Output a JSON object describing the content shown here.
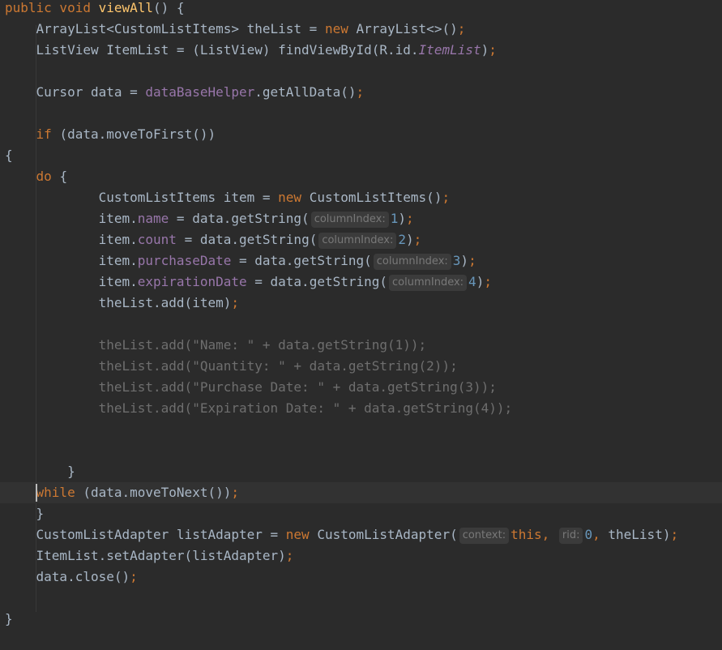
{
  "editor": {
    "lines": [
      {
        "indent": "",
        "tokens": [
          {
            "c": "kw",
            "t": "public void "
          },
          {
            "c": "fn",
            "t": "viewAll"
          },
          {
            "c": "",
            "t": "() {"
          }
        ]
      },
      {
        "indent": "    ",
        "tokens": [
          {
            "c": "",
            "t": "ArrayList<CustomListItems> theList = "
          },
          {
            "c": "kw",
            "t": "new "
          },
          {
            "c": "",
            "t": "ArrayList<>()"
          },
          {
            "c": "kw",
            "t": ";"
          }
        ]
      },
      {
        "indent": "    ",
        "tokens": [
          {
            "c": "",
            "t": "ListView ItemList = (ListView) findViewById(R.id."
          },
          {
            "c": "fldi",
            "t": "ItemList"
          },
          {
            "c": "",
            "t": ")"
          },
          {
            "c": "kw",
            "t": ";"
          }
        ]
      },
      {
        "indent": "",
        "tokens": []
      },
      {
        "indent": "    ",
        "tokens": [
          {
            "c": "",
            "t": "Cursor data = "
          },
          {
            "c": "fld",
            "t": "dataBaseHelper"
          },
          {
            "c": "",
            "t": ".getAllData()"
          },
          {
            "c": "kw",
            "t": ";"
          }
        ]
      },
      {
        "indent": "",
        "tokens": []
      },
      {
        "indent": "    ",
        "tokens": [
          {
            "c": "kw",
            "t": "if "
          },
          {
            "c": "",
            "t": "(data.moveToFirst())"
          }
        ]
      },
      {
        "indent": "",
        "tokens": [
          {
            "c": "",
            "t": "{"
          }
        ]
      },
      {
        "indent": "    ",
        "tokens": [
          {
            "c": "kw",
            "t": "do "
          },
          {
            "c": "",
            "t": "{"
          }
        ]
      },
      {
        "indent": "            ",
        "tokens": [
          {
            "c": "",
            "t": "CustomListItems item = "
          },
          {
            "c": "kw",
            "t": "new "
          },
          {
            "c": "",
            "t": "CustomListItems()"
          },
          {
            "c": "kw",
            "t": ";"
          }
        ]
      },
      {
        "indent": "            ",
        "tokens": [
          {
            "c": "",
            "t": "item."
          },
          {
            "c": "fld",
            "t": "name"
          },
          {
            "c": "",
            "t": " = data.getString("
          },
          {
            "c": "hint",
            "t": "columnIndex:"
          },
          {
            "c": "num",
            "t": "1"
          },
          {
            "c": "",
            "t": ")"
          },
          {
            "c": "kw",
            "t": ";"
          }
        ]
      },
      {
        "indent": "            ",
        "tokens": [
          {
            "c": "",
            "t": "item."
          },
          {
            "c": "fld",
            "t": "count"
          },
          {
            "c": "",
            "t": " = data.getString("
          },
          {
            "c": "hint",
            "t": "columnIndex:"
          },
          {
            "c": "num",
            "t": "2"
          },
          {
            "c": "",
            "t": ")"
          },
          {
            "c": "kw",
            "t": ";"
          }
        ]
      },
      {
        "indent": "            ",
        "tokens": [
          {
            "c": "",
            "t": "item."
          },
          {
            "c": "fld",
            "t": "purchaseDate"
          },
          {
            "c": "",
            "t": " = data.getString("
          },
          {
            "c": "hint",
            "t": "columnIndex:"
          },
          {
            "c": "num",
            "t": "3"
          },
          {
            "c": "",
            "t": ")"
          },
          {
            "c": "kw",
            "t": ";"
          }
        ]
      },
      {
        "indent": "            ",
        "tokens": [
          {
            "c": "",
            "t": "item."
          },
          {
            "c": "fld",
            "t": "expirationDate"
          },
          {
            "c": "",
            "t": " = data.getString("
          },
          {
            "c": "hint",
            "t": "columnIndex:"
          },
          {
            "c": "num",
            "t": "4"
          },
          {
            "c": "",
            "t": ")"
          },
          {
            "c": "kw",
            "t": ";"
          }
        ]
      },
      {
        "indent": "            ",
        "tokens": [
          {
            "c": "",
            "t": "theList.add(item)"
          },
          {
            "c": "kw",
            "t": ";"
          }
        ]
      },
      {
        "indent": "",
        "tokens": []
      },
      {
        "indent": "            ",
        "tokens": [
          {
            "c": "dim",
            "t": "theList.add(\"Name: \" + data.getString(1));"
          }
        ]
      },
      {
        "indent": "            ",
        "tokens": [
          {
            "c": "dim",
            "t": "theList.add(\"Quantity: \" + data.getString(2));"
          }
        ]
      },
      {
        "indent": "            ",
        "tokens": [
          {
            "c": "dim",
            "t": "theList.add(\"Purchase Date: \" + data.getString(3));"
          }
        ]
      },
      {
        "indent": "            ",
        "tokens": [
          {
            "c": "dim",
            "t": "theList.add(\"Expiration Date: \" + data.getString(4));"
          }
        ]
      },
      {
        "indent": "",
        "tokens": []
      },
      {
        "indent": "",
        "tokens": []
      },
      {
        "indent": "        ",
        "tokens": [
          {
            "c": "",
            "t": "}"
          }
        ]
      },
      {
        "indent": "    ",
        "current": true,
        "tokens": [
          {
            "c": "kw",
            "t": "while "
          },
          {
            "c": "",
            "t": "(data.moveToNext())"
          },
          {
            "c": "kw",
            "t": ";"
          }
        ]
      },
      {
        "indent": "    ",
        "tokens": [
          {
            "c": "",
            "t": "}"
          }
        ]
      },
      {
        "indent": "    ",
        "tokens": [
          {
            "c": "",
            "t": "CustomListAdapter listAdapter = "
          },
          {
            "c": "kw",
            "t": "new "
          },
          {
            "c": "",
            "t": "CustomListAdapter("
          },
          {
            "c": "hint",
            "t": "context:"
          },
          {
            "c": "kw",
            "t": "this, "
          },
          {
            "c": "hint",
            "t": "rid:"
          },
          {
            "c": "num",
            "t": "0"
          },
          {
            "c": "kw",
            "t": ", "
          },
          {
            "c": "",
            "t": "theList)"
          },
          {
            "c": "kw",
            "t": ";"
          }
        ]
      },
      {
        "indent": "    ",
        "tokens": [
          {
            "c": "",
            "t": "ItemList.setAdapter(listAdapter)"
          },
          {
            "c": "kw",
            "t": ";"
          }
        ]
      },
      {
        "indent": "    ",
        "tokens": [
          {
            "c": "",
            "t": "data.close()"
          },
          {
            "c": "kw",
            "t": ";"
          }
        ]
      },
      {
        "indent": "",
        "tokens": []
      },
      {
        "indent": "",
        "tokens": [
          {
            "c": "",
            "t": "}"
          }
        ]
      }
    ]
  }
}
